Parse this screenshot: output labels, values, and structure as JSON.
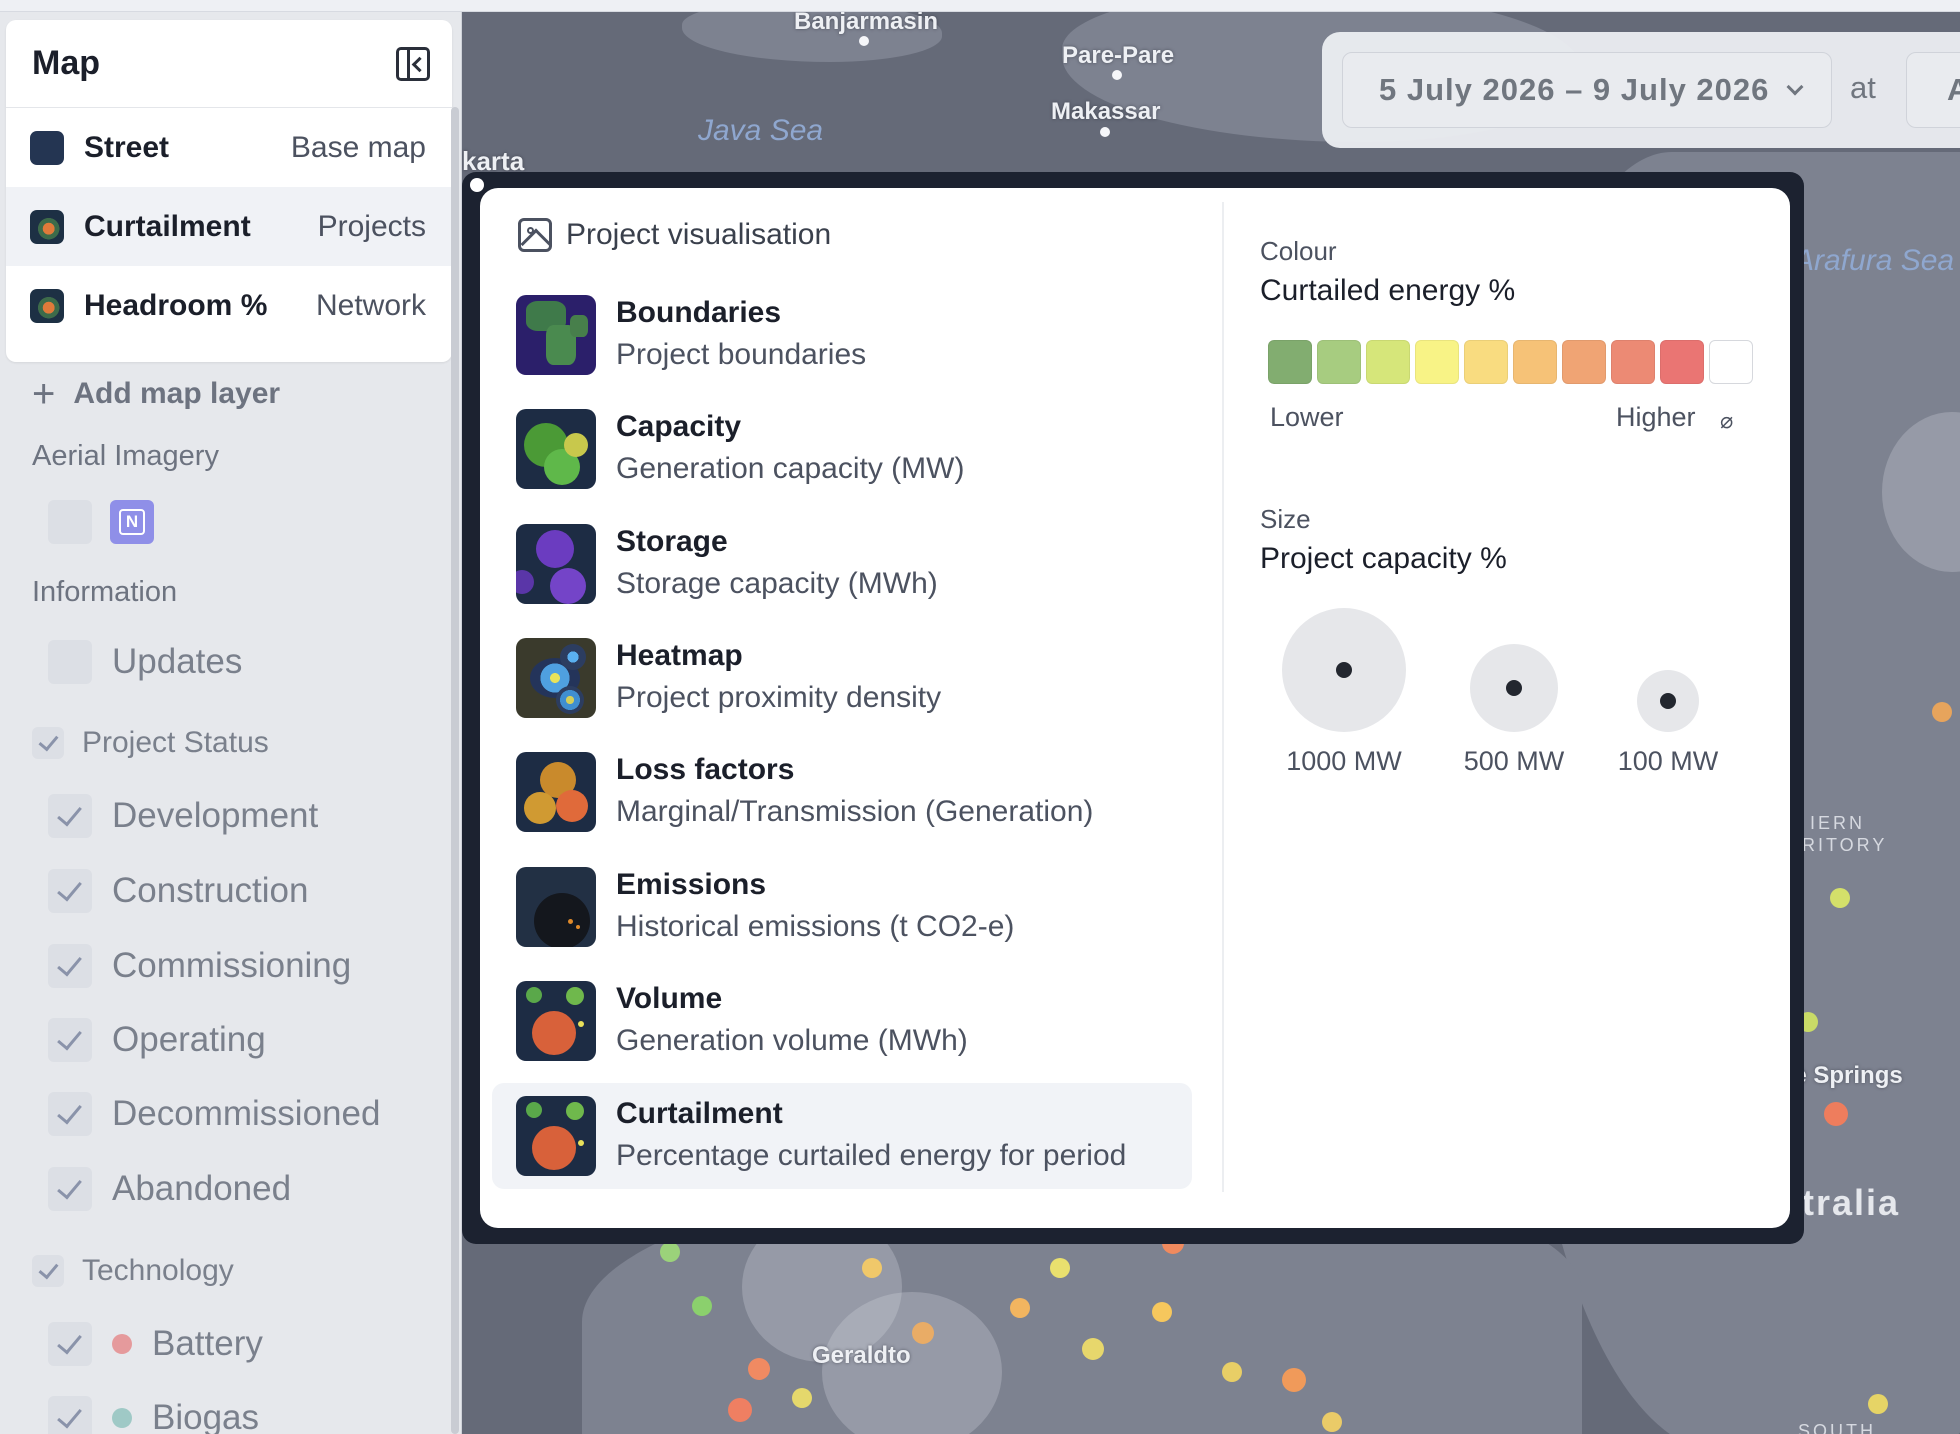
{
  "sidebar": {
    "title": "Map",
    "layers": [
      {
        "name": "Street",
        "type": "Base map"
      },
      {
        "name": "Curtailment",
        "type": "Projects"
      },
      {
        "name": "Headroom %",
        "type": "Network"
      }
    ],
    "add_layer_label": "Add map layer",
    "aerial_label": "Aerial Imagery",
    "aerial_badge": "N",
    "information_label": "Information",
    "updates_label": "Updates",
    "project_status": {
      "label": "Project Status",
      "items": [
        "Development",
        "Construction",
        "Commissioning",
        "Operating",
        "Decommissioned",
        "Abandoned"
      ]
    },
    "technology": {
      "label": "Technology",
      "items": [
        {
          "name": "Battery",
          "color": "#e59a9c"
        },
        {
          "name": "Biogas",
          "color": "#9fc9c6"
        }
      ]
    }
  },
  "date_bar": {
    "date_range": "5 July 2026 – 9 July 2026",
    "at_label": "at",
    "time_partial": "A"
  },
  "map_labels": {
    "banjarmasin": "Banjarmasin",
    "parepare": "Pare-Pare",
    "makassar": "Makassar",
    "java_sea": "Java Sea",
    "arafura_sea": "Arafura Sea",
    "jakarta_partial": "karta",
    "territory_line1": "R  IERN",
    "territory_line2": "RRITORY",
    "alice_springs_partial": "ce Springs",
    "australia_partial": "stralia",
    "geraldton_partial": "Geraldto",
    "south_partial": "SOUTH",
    "e_partial": "e"
  },
  "popup": {
    "title": "Project visualisation",
    "items": [
      {
        "name": "Boundaries",
        "desc": "Project boundaries"
      },
      {
        "name": "Capacity",
        "desc": "Generation capacity (MW)"
      },
      {
        "name": "Storage",
        "desc": "Storage capacity (MWh)"
      },
      {
        "name": "Heatmap",
        "desc": "Project proximity density"
      },
      {
        "name": "Loss factors",
        "desc": "Marginal/Transmission (Generation)"
      },
      {
        "name": "Emissions",
        "desc": "Historical emissions (t CO2-e)"
      },
      {
        "name": "Volume",
        "desc": "Generation volume (MWh)"
      },
      {
        "name": "Curtailment",
        "desc": "Percentage curtailed energy for period"
      }
    ],
    "selected": "Curtailment",
    "colour": {
      "label": "Colour",
      "title": "Curtailed energy %",
      "scale_colors": [
        "#82ad70",
        "#a7cc80",
        "#d6e67a",
        "#f8f386",
        "#f9dc80",
        "#f6c277",
        "#f0a474",
        "#ec8a74",
        "#ea7573",
        "#ffffff"
      ],
      "lower_label": "Lower",
      "higher_label": "Higher",
      "null_symbol": "⌀"
    },
    "size": {
      "label": "Size",
      "title": "Project capacity %",
      "circles": [
        "1000 MW",
        "500 MW",
        "100 MW"
      ]
    }
  }
}
